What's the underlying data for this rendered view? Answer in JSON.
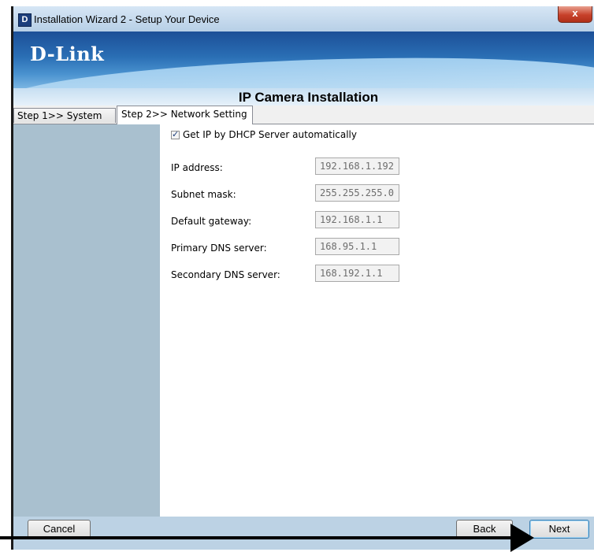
{
  "window": {
    "title": "Installation Wizard 2 - Setup Your Device",
    "close_label": "x",
    "app_icon": "D"
  },
  "banner": {
    "logo": "D-Link"
  },
  "header": {
    "title": "IP Camera Installation"
  },
  "tabs": [
    {
      "label": "Step 1>> System",
      "active": false
    },
    {
      "label": "Step 2>> Network Setting",
      "active": true
    }
  ],
  "network": {
    "dhcp_label": "Get IP by DHCP Server automatically",
    "dhcp_checked": true,
    "fields": [
      {
        "label": "IP address:",
        "value": "192.168.1.192"
      },
      {
        "label": "Subnet mask:",
        "value": "255.255.255.0"
      },
      {
        "label": "Default gateway:",
        "value": "192.168.1.1"
      },
      {
        "label": "Primary DNS server:",
        "value": "168.95.1.1"
      },
      {
        "label": "Secondary DNS server:",
        "value": "168.192.1.1"
      }
    ]
  },
  "footer": {
    "cancel_label": "Cancel",
    "back_label": "Back",
    "next_label": "Next"
  },
  "colors": {
    "banner": "#2a6fb5",
    "sidebar": "#a9c0cf",
    "frame": "#bcd2e4"
  },
  "icons": {
    "app": "d-link-app-icon",
    "close": "close-icon",
    "check": "checkmark-icon",
    "annotation": "arrow-right-icon"
  }
}
